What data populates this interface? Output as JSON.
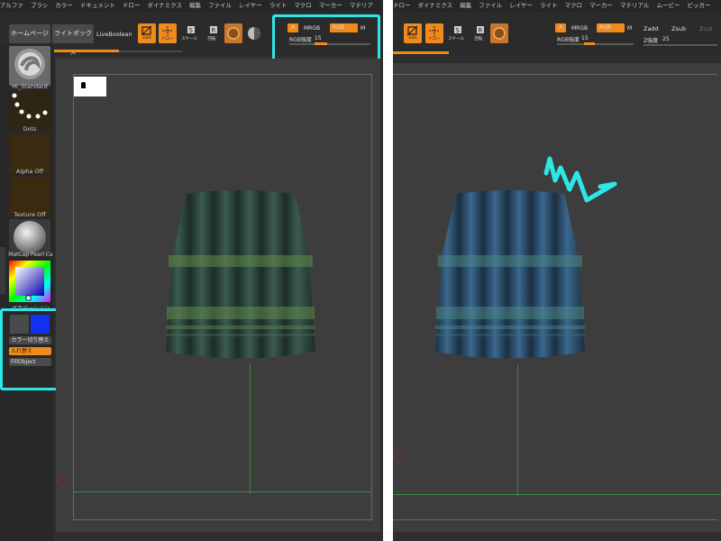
{
  "menu_left": [
    "アルファ",
    "ブラシ",
    "カラー",
    "ドキュメント",
    "ドロー",
    "ダイナミクス",
    "編集",
    "ファイル",
    "レイヤー",
    "ライト",
    "マクロ",
    "マーカー",
    "マテリア"
  ],
  "menu_right": [
    "ドロー",
    "ダイナミクス",
    "編集",
    "ファイル",
    "レイヤー",
    "ライト",
    "マクロ",
    "マーカー",
    "マテリアル",
    "ムービー",
    "ピッカー"
  ],
  "toolbar": {
    "home": "ホームページ",
    "lightbox": "ライトボックス",
    "liveboolean": "LiveBoolean",
    "edit": "Edit",
    "draw": "ドロー",
    "scale": "スケール",
    "rotate": "回転"
  },
  "rgb_panel": {
    "a": "A",
    "mrgb": "MRGB",
    "rgb": "RGB",
    "m": "M",
    "rgb_intensity_label": "RGB強度",
    "rgb_intensity_value": "15",
    "rgb_intensity_level": 0.15
  },
  "right_panel": {
    "zadd": "Zadd",
    "zsub": "Zsub",
    "zcut": "Zcut",
    "z_intensity_label": "Z強度",
    "z_intensity_value": "25"
  },
  "sidebar": {
    "brush": "Hi_Standard",
    "stroke": "Dots",
    "alpha": "Alpha Off",
    "texture": "Texture Off",
    "material": "MatCap Pearl Ca",
    "gradient": "グラデーション",
    "switch_color": "カラー切り替え",
    "swap": "入れ替え",
    "fill_object": "FillObject"
  },
  "colors": {
    "accent": "#f08a1c",
    "highlight": "#2ee6e6",
    "main_color": "#4a4a4a",
    "secondary_color": "#1133ee",
    "skirt_left": "#2f4a43",
    "skirt_right": "#2f5570"
  }
}
